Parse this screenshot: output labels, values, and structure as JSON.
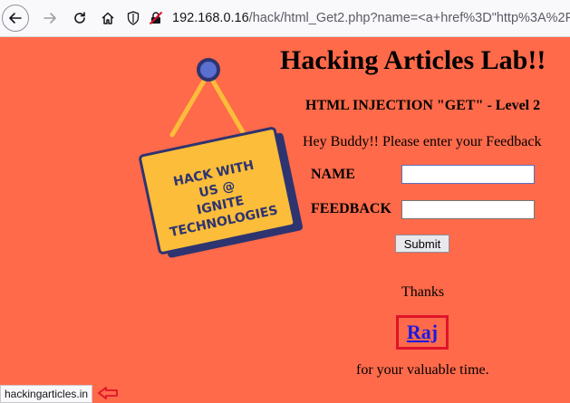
{
  "browser": {
    "url_host": "192.168.0.16",
    "url_rest": "/hack/html_Get2.php?name=<a+href%3D\"http%3A%2F%"
  },
  "page": {
    "title": "Hacking Articles Lab!!",
    "subtitle": "HTML INJECTION \"GET\" - Level 2",
    "prompt": "Hey Buddy!! Please enter your Feedback",
    "name_label": "NAME",
    "feedback_label": "FEEDBACK",
    "name_value": "",
    "feedback_value": "",
    "submit_label": "Submit",
    "thanks": "Thanks",
    "link_text": "Raj",
    "closing": "for your valuable time.",
    "sign_text": [
      "HACK WITH",
      "US @",
      "IGNITE",
      "TECHNOLOGIES"
    ]
  },
  "status_bar": {
    "text": "hackingarticles.in"
  },
  "colors": {
    "page_background": "#ff6a4a",
    "sign_yellow": "#fbbd3a",
    "sign_navy": "#2e3470",
    "link_box": "#e0142a",
    "link": "#1a1ae0"
  }
}
